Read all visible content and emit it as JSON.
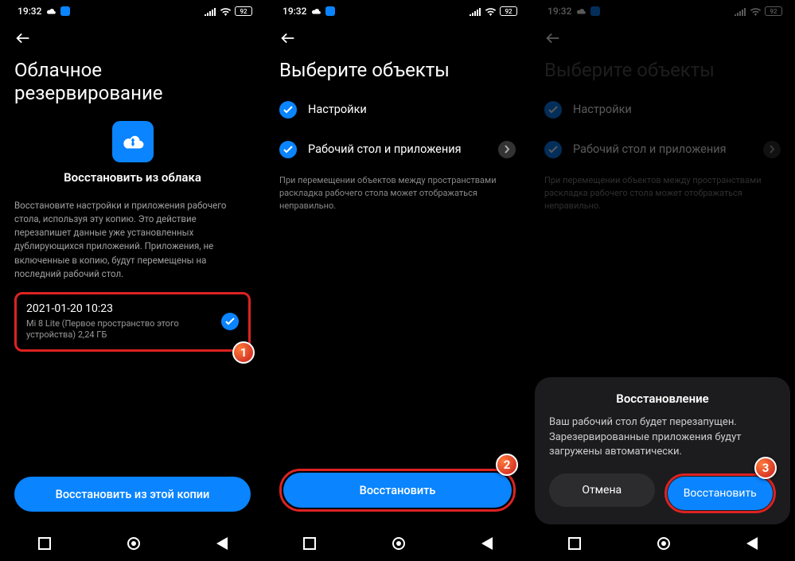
{
  "status": {
    "time": "19:32",
    "battery": "92"
  },
  "screen1": {
    "title": "Облачное резервирование",
    "subhead": "Восстановить из облака",
    "desc": "Восстановите настройки и приложения рабочего стола, используя эту копию. Это действие перезапишет данные уже установленных дублирующихся приложений. Приложения, не включенные в копию, будут перемещены на последний рабочий стол.",
    "backup": {
      "date": "2021-01-20 10:23",
      "sub": "Mi 8 Lite (Первое пространство этого устройства) 2,24 ГБ"
    },
    "button": "Восстановить из этой копии",
    "badge": "1"
  },
  "screen2": {
    "title": "Выберите объекты",
    "opt1": "Настройки",
    "opt2": "Рабочий стол и приложения",
    "note": "При перемещении объектов между пространствами раскладка рабочего стола может отображаться неправильно.",
    "button": "Восстановить",
    "badge": "2"
  },
  "screen3": {
    "title": "Выберите объекты",
    "opt1": "Настройки",
    "opt2": "Рабочий стол и приложения",
    "note": "При перемещении объектов между пространствами раскладка рабочего стола может отображаться неправильно.",
    "dialog": {
      "title": "Восстановление",
      "body": "Ваш рабочий стол будет перезапущен. Зарезервированные приложения будут загружены автоматически.",
      "cancel": "Отмена",
      "ok": "Восстановить"
    },
    "badge": "3"
  }
}
